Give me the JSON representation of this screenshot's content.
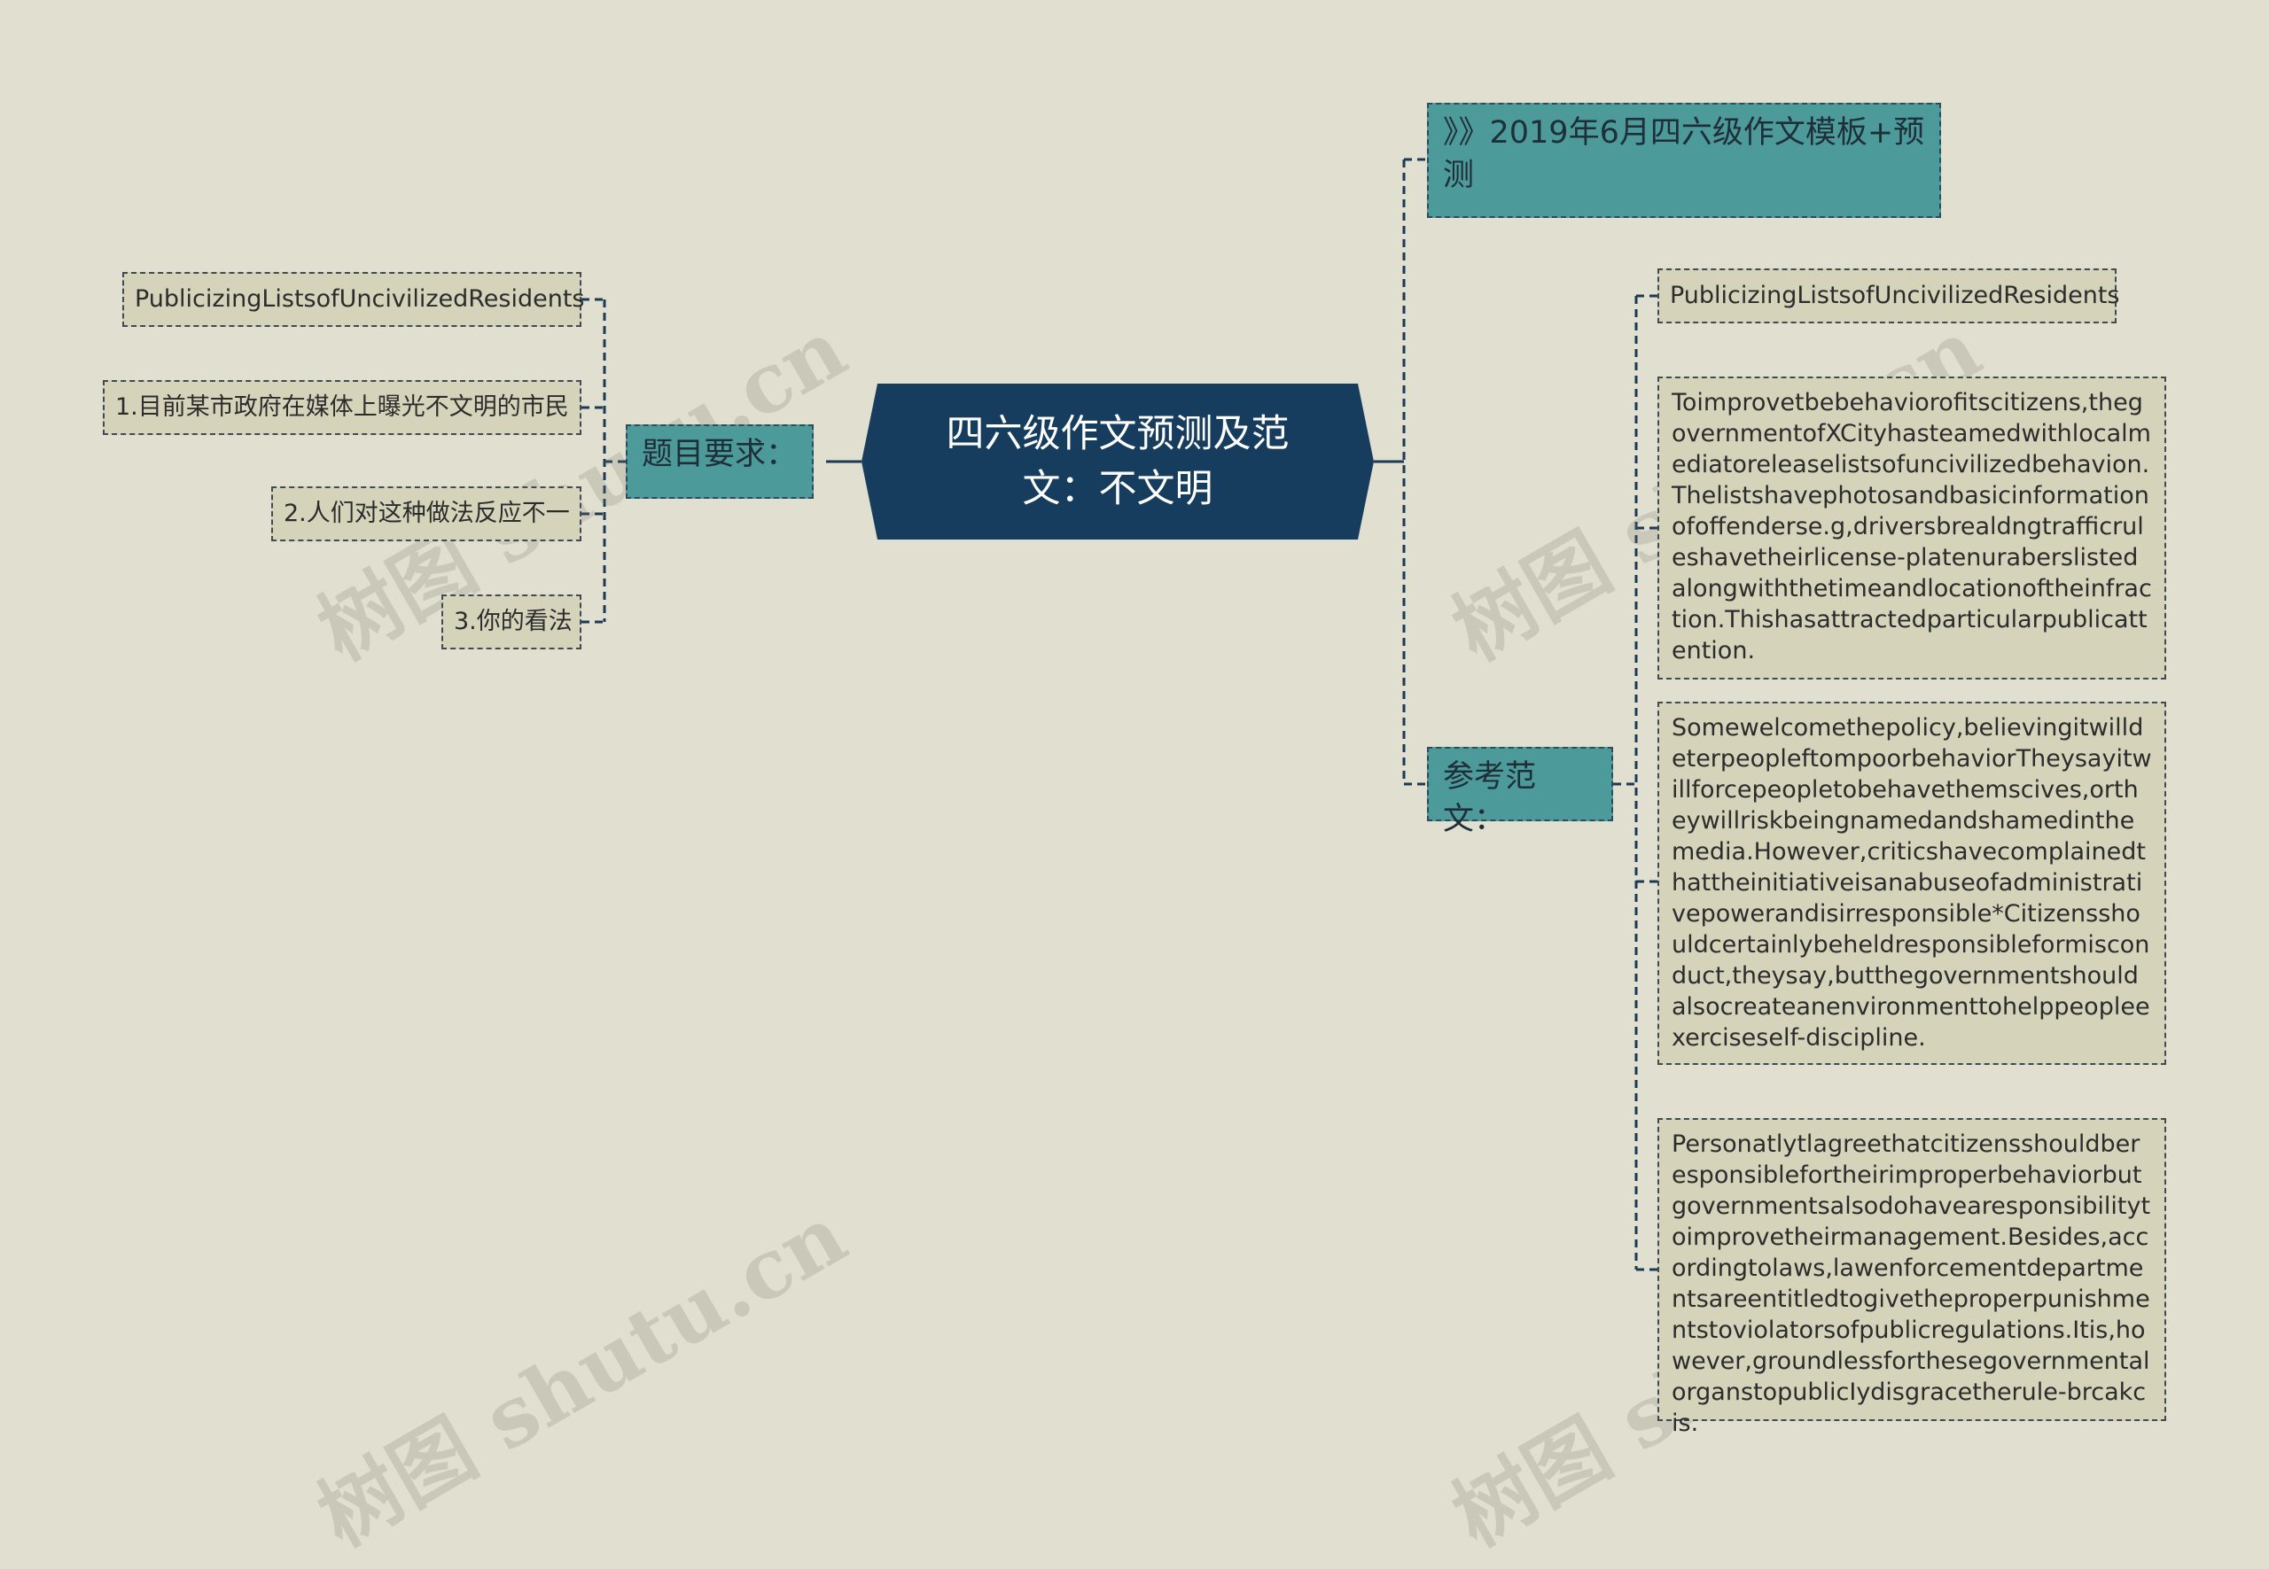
{
  "center": {
    "title": "四六级作文预测及范文：不文明"
  },
  "left": {
    "branch_label": "题目要求：",
    "items": [
      "PublicizingListsofUncivilizedResidents",
      "1.目前某市政府在媒体上曝光不文明的市民",
      "2.人们对这种做法反应不一",
      "3.你的看法"
    ]
  },
  "right": {
    "link_label": "》》2019年6月四六级作文模板+预测",
    "branch_label": "参考范文：",
    "items": [
      "PublicizingListsofUncivilizedResidents",
      "Toimprovetbebehaviorofitscitizens,thegovernmentofXCityhasteamedwithlocalmediatoreleaselistsofuncivilizedbehavion.Thelistshavephotosandbasicinformationofoffenderse.g,driversbrealdngtrafficruleshavetheirlicense-platenuraberslistedalongwiththetimeandlocationoftheinfraction.Thishasattractedparticularpublicattention.",
      "Somewelcomethepolicy,believingitwilldeterpeopleftompoorbehaviorTheysayitwillforcepeopletobehavethemscives,ortheywillriskbeingnamedandshamedinthemedia.However,criticshavecomplainedthattheinitiativeisanabuseofadministrativepowerandisirresponsible*Citizensshouldcertainlybeheldresponsibleformisconduct,theysay,butthegovernmentshouldalsocreateanenvironmenttohelppeopleexerciseself-discipline.",
      "Personatlytlagreethatcitizensshouldberesponsiblefortheirimproperbehaviorbutgovernmentsalsodohavearesponsibilitytoimprovetheirmanagement.Besides,accordingtolaws,lawenforcementdepartmentsareentitledtogivetheproperpunishmentstoviolatorsofpublicregulations.Itis,however,groundlessforthesegovernmentalorganstopublicIydisgracetherule-brcakcis."
    ]
  },
  "watermark": "树图 shutu.cn",
  "colors": {
    "background": "#e0dfd0",
    "center_fill": "#173d5e",
    "teal": "#4d9a9b",
    "leaf": "#d6d3bb",
    "line": "#1d3a55"
  }
}
